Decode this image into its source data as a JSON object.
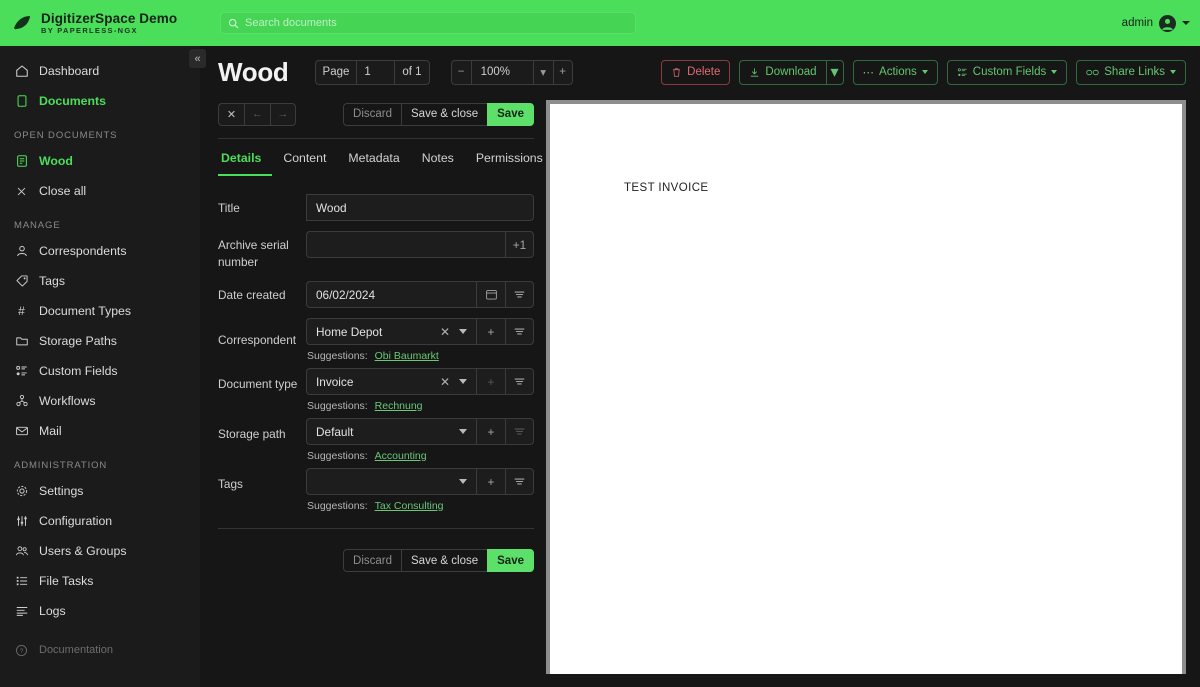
{
  "topbar": {
    "brand_title": "DigitizerSpace Demo",
    "brand_subtitle": "BY PAPERLESS-NGX",
    "logo_icon": "leaf-icon",
    "search": {
      "placeholder": "Search documents",
      "value": "",
      "icon": "search-icon"
    },
    "user": {
      "name": "admin",
      "avatar_icon": "user-avatar-icon",
      "caret_icon": "caret-down-icon"
    },
    "accent_color": "#4ade5a"
  },
  "sidebar": {
    "collapse_icon": "chevron-double-left-icon",
    "groups": [
      {
        "label": "",
        "items": [
          {
            "label": "Dashboard",
            "icon": "home-icon",
            "active": false
          },
          {
            "label": "Documents",
            "icon": "document-icon",
            "active": true
          }
        ]
      },
      {
        "label": "OPEN DOCUMENTS",
        "items": [
          {
            "label": "Wood",
            "icon": "open-document-icon",
            "active": true
          },
          {
            "label": "Close all",
            "icon": "close-x-icon",
            "active": false
          }
        ]
      },
      {
        "label": "MANAGE",
        "items": [
          {
            "label": "Correspondents",
            "icon": "person-icon",
            "active": false
          },
          {
            "label": "Tags",
            "icon": "tag-icon",
            "active": false
          },
          {
            "label": "Document Types",
            "icon": "hash-icon",
            "active": false
          },
          {
            "label": "Storage Paths",
            "icon": "folder-icon",
            "active": false
          },
          {
            "label": "Custom Fields",
            "icon": "sliders-list-icon",
            "active": false
          },
          {
            "label": "Workflows",
            "icon": "workflow-icon",
            "active": false
          },
          {
            "label": "Mail",
            "icon": "envelope-icon",
            "active": false
          }
        ]
      },
      {
        "label": "ADMINISTRATION",
        "items": [
          {
            "label": "Settings",
            "icon": "gear-icon",
            "active": false
          },
          {
            "label": "Configuration",
            "icon": "sliders-icon",
            "active": false
          },
          {
            "label": "Users & Groups",
            "icon": "people-icon",
            "active": false
          },
          {
            "label": "File Tasks",
            "icon": "list-task-icon",
            "active": false
          },
          {
            "label": "Logs",
            "icon": "list-lines-icon",
            "active": false
          },
          {
            "label": "Documentation",
            "icon": "question-circle-icon",
            "active": false,
            "dim": true
          }
        ]
      }
    ]
  },
  "document": {
    "title": "Wood",
    "pager": {
      "page_label": "Page",
      "page_value": "1",
      "of_label": "of 1"
    },
    "zoom": {
      "minus": "−",
      "value": "100%",
      "plus": "+",
      "caret_icon": "chevron-down-icon"
    },
    "toolbar": {
      "delete_label": "Delete",
      "delete_icon": "trash-icon",
      "download_label": "Download",
      "download_icon": "download-icon",
      "actions_label": "Actions",
      "actions_icon": "ellipsis-icon",
      "custom_fields_label": "Custom Fields",
      "custom_fields_icon": "custom-fields-icon",
      "share_links_label": "Share Links",
      "share_links_icon": "link-icon"
    }
  },
  "editor": {
    "nav": {
      "close_icon": "close-x-icon",
      "prev_icon": "arrow-left-icon",
      "next_icon": "arrow-right-icon"
    },
    "actions": {
      "discard": "Discard",
      "save_and_close": "Save & close",
      "save": "Save"
    },
    "tabs": [
      {
        "label": "Details",
        "active": true
      },
      {
        "label": "Content",
        "active": false
      },
      {
        "label": "Metadata",
        "active": false
      },
      {
        "label": "Notes",
        "active": false
      },
      {
        "label": "Permissions",
        "active": false
      }
    ],
    "fields": {
      "title": {
        "label": "Title",
        "value": "Wood"
      },
      "asn": {
        "label": "Archive serial number",
        "value": "",
        "addon_label": "+1"
      },
      "date_created": {
        "label": "Date created",
        "value": "06/02/2024",
        "calendar_icon": "calendar-icon",
        "filter_icon": "filter-lines-icon"
      },
      "correspondent": {
        "label": "Correspondent",
        "value": "Home Depot",
        "suggestions_label": "Suggestions:",
        "suggestion": "Obi Baumarkt",
        "clear_icon": "clear-x-icon",
        "add_icon": "plus-icon",
        "filter_icon": "filter-lines-icon"
      },
      "document_type": {
        "label": "Document type",
        "value": "Invoice",
        "suggestions_label": "Suggestions:",
        "suggestion": "Rechnung",
        "clear_icon": "clear-x-icon",
        "add_icon": "plus-icon",
        "filter_icon": "filter-lines-icon"
      },
      "storage_path": {
        "label": "Storage path",
        "value": "Default",
        "suggestions_label": "Suggestions:",
        "suggestion": "Accounting",
        "add_icon": "plus-icon",
        "filter_icon": "filter-lines-icon"
      },
      "tags": {
        "label": "Tags",
        "value": "",
        "suggestions_label": "Suggestions:",
        "suggestion": "Tax Consulting",
        "add_icon": "plus-icon",
        "filter_icon": "filter-lines-icon"
      }
    }
  },
  "preview": {
    "page_text": "TEST INVOICE"
  }
}
